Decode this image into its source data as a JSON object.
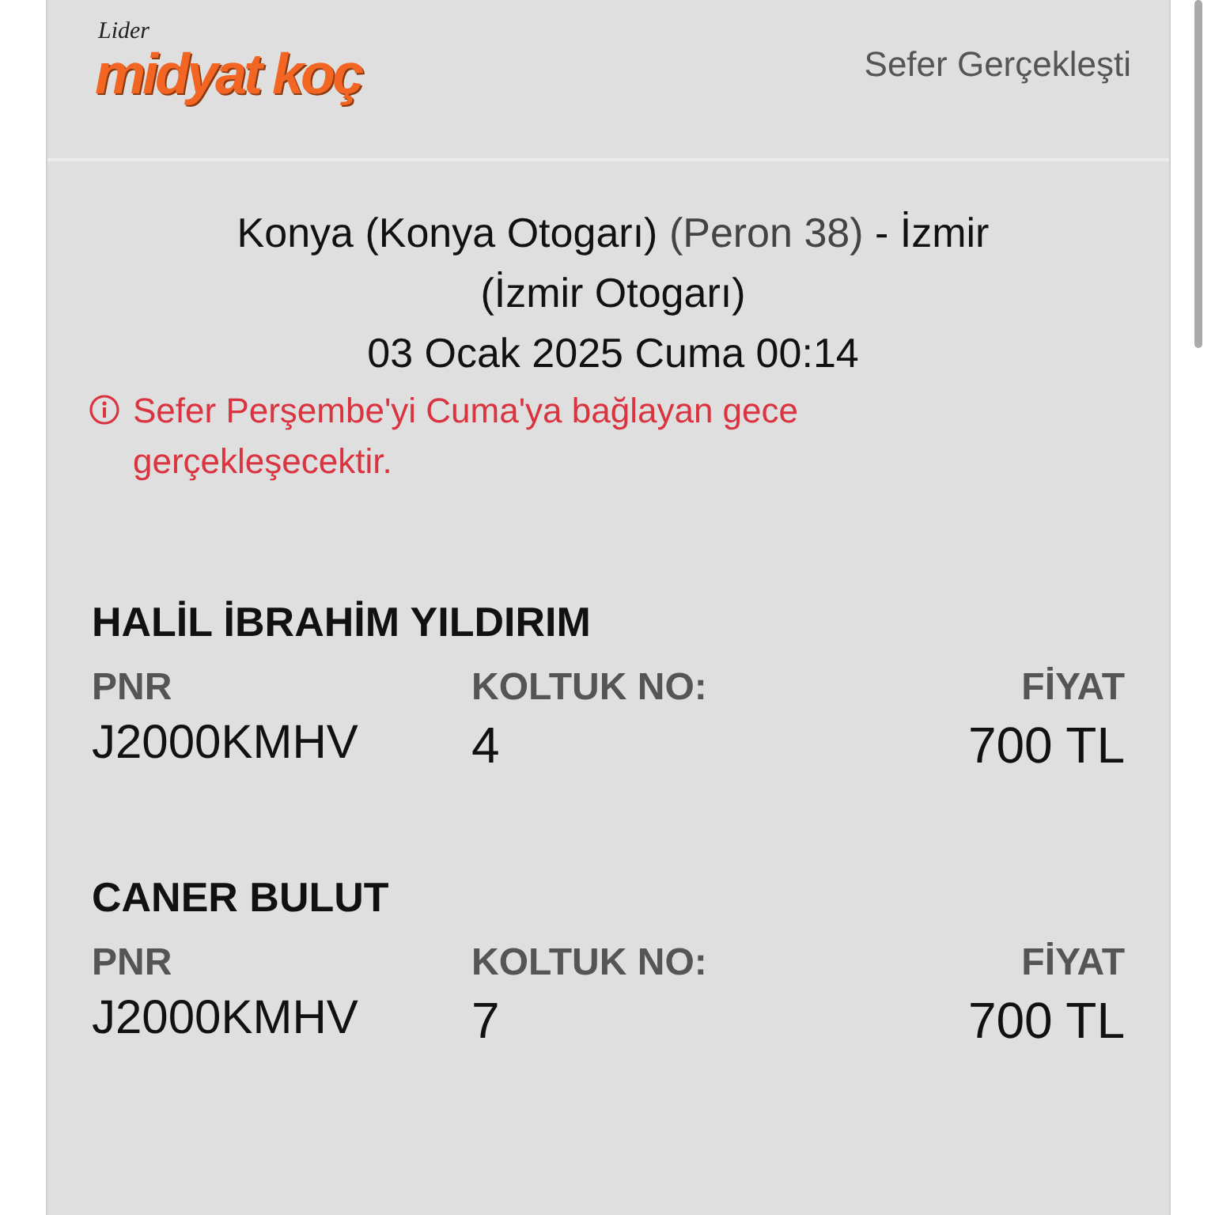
{
  "header": {
    "logo_small": "Lider",
    "logo_main": "midyat koç",
    "status": "Sefer Gerçekleşti"
  },
  "trip": {
    "origin": "Konya (Konya Otogarı)",
    "platform": "(Peron 38)",
    "destination": "- İzmir (İzmir Otogarı)",
    "datetime": "03 Ocak 2025 Cuma 00:14",
    "warning": "Sefer Perşembe'yi Cuma'ya bağlayan gece gerçekleşecektir."
  },
  "passengers": [
    {
      "name": "HALİL İBRAHİM YILDIRIM",
      "pnr_label": "PNR",
      "pnr": "J2000KMHV",
      "seat_label": "KOLTUK NO:",
      "seat": "4",
      "price_label": "FİYAT",
      "price": "700 TL"
    },
    {
      "name": "CANER BULUT",
      "pnr_label": "PNR",
      "pnr": "J2000KMHV",
      "seat_label": "KOLTUK NO:",
      "seat": "7",
      "price_label": "FİYAT",
      "price": "700 TL"
    }
  ]
}
